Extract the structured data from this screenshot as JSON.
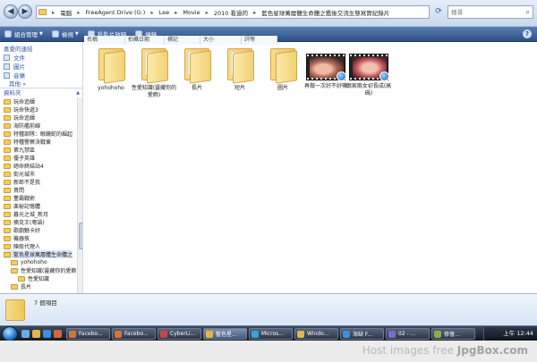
{
  "address_bar": {
    "crumbs": [
      "電腦",
      "FreeAgent Drive (G:)",
      "Lee",
      "Movie",
      "2010 看過的",
      "藍色星球萬層體生命體之鑑後交流生態寫實紀錄片"
    ],
    "search_placeholder": "搜尋"
  },
  "toolbar": {
    "organize": "組合管理",
    "views": "檢視",
    "slideshow": "投影片放映",
    "burn": "燒錄"
  },
  "left_pane": {
    "favorites_title": "喜愛的連結",
    "favorites": [
      "文件",
      "圖片",
      "音樂"
    ],
    "more": "其他 »",
    "folders_title": "資料夾",
    "tree": [
      {
        "label": "玩命追緝",
        "indent": 0
      },
      {
        "label": "玩命快遞3",
        "indent": 0
      },
      {
        "label": "玩命追緝",
        "indent": 0
      },
      {
        "label": "海防艦前線",
        "indent": 0
      },
      {
        "label": "特種部隊：眼鏡蛇的崛起",
        "indent": 0
      },
      {
        "label": "特種警察決戰東",
        "indent": 0
      },
      {
        "label": "第九禁區",
        "indent": 0
      },
      {
        "label": "優子英雄",
        "indent": 0
      },
      {
        "label": "絕命終結站4",
        "indent": 0
      },
      {
        "label": "街光城市",
        "indent": 0
      },
      {
        "label": "新郎不是我",
        "indent": 0
      },
      {
        "label": "貴問",
        "indent": 0
      },
      {
        "label": "董霸戰術",
        "indent": 0
      },
      {
        "label": "楽秘記憶體",
        "indent": 0
      },
      {
        "label": "暮光之城_新月",
        "indent": 0
      },
      {
        "label": "摘克王(粵語)",
        "indent": 0
      },
      {
        "label": "歌劇魅卡好",
        "indent": 0
      },
      {
        "label": "機器俠",
        "indent": 0
      },
      {
        "label": "陳般代理人",
        "indent": 0
      },
      {
        "label": "藍色星球萬層體生命體之",
        "indent": 0,
        "selected": true
      },
      {
        "label": "yohohoho",
        "indent": 1
      },
      {
        "label": "性愛知識(靈藏你的愛飾)",
        "indent": 1
      },
      {
        "label": "性愛知識",
        "indent": 2
      },
      {
        "label": "長片",
        "indent": 1
      }
    ]
  },
  "columns": [
    "名稱",
    "拍攝日期",
    "標記",
    "大小",
    "評等"
  ],
  "items": [
    {
      "label": "yohohoho",
      "kind": "folder"
    },
    {
      "label": "性愛知識(靈藏你的愛飾)",
      "kind": "folder-docs"
    },
    {
      "label": "長片",
      "kind": "folder-docs"
    },
    {
      "label": "短片",
      "kind": "folder-docs"
    },
    {
      "label": "圖片",
      "kind": "folder"
    },
    {
      "label": "再做一次好不好嘛",
      "kind": "video1"
    },
    {
      "label": "跟家兩女初長成(高碼)",
      "kind": "video2"
    }
  ],
  "details": {
    "count": "7 個項目"
  },
  "taskbar": {
    "tasks": [
      "Facebo...",
      "Facebo...",
      "CyberLi...",
      "藍色星...",
      "Micros...",
      "Windo...",
      "海缺 F...",
      "02 - ...",
      "修復..."
    ],
    "clock": "上午 12:44"
  },
  "watermark": {
    "prefix": "Host images free ",
    "brand": "JpgBox.com"
  }
}
